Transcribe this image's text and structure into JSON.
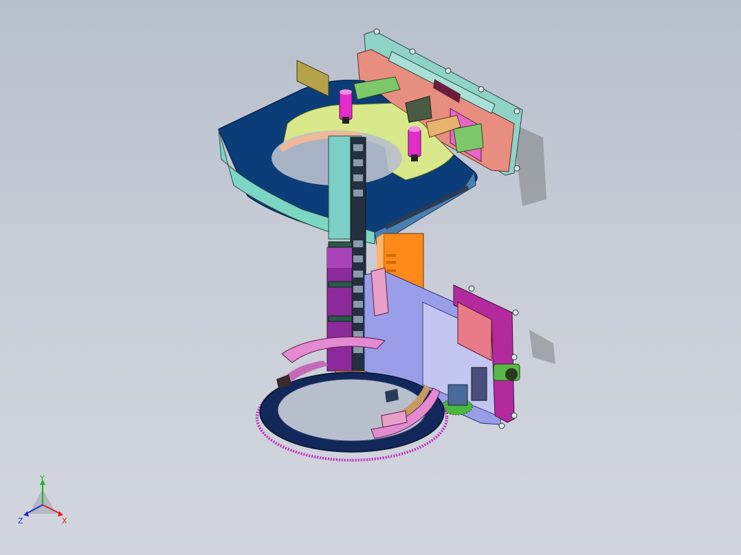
{
  "viewport": {
    "background_top": "#b7bfcc",
    "background_bottom": "#d3d6de"
  },
  "model": {
    "description_icon": "cad-assembly-model"
  },
  "triad": {
    "x_label": "X",
    "y_label": "Y",
    "z_label": "Z",
    "x_color": "#e02020",
    "y_color": "#20b020",
    "z_color": "#2030d0"
  }
}
